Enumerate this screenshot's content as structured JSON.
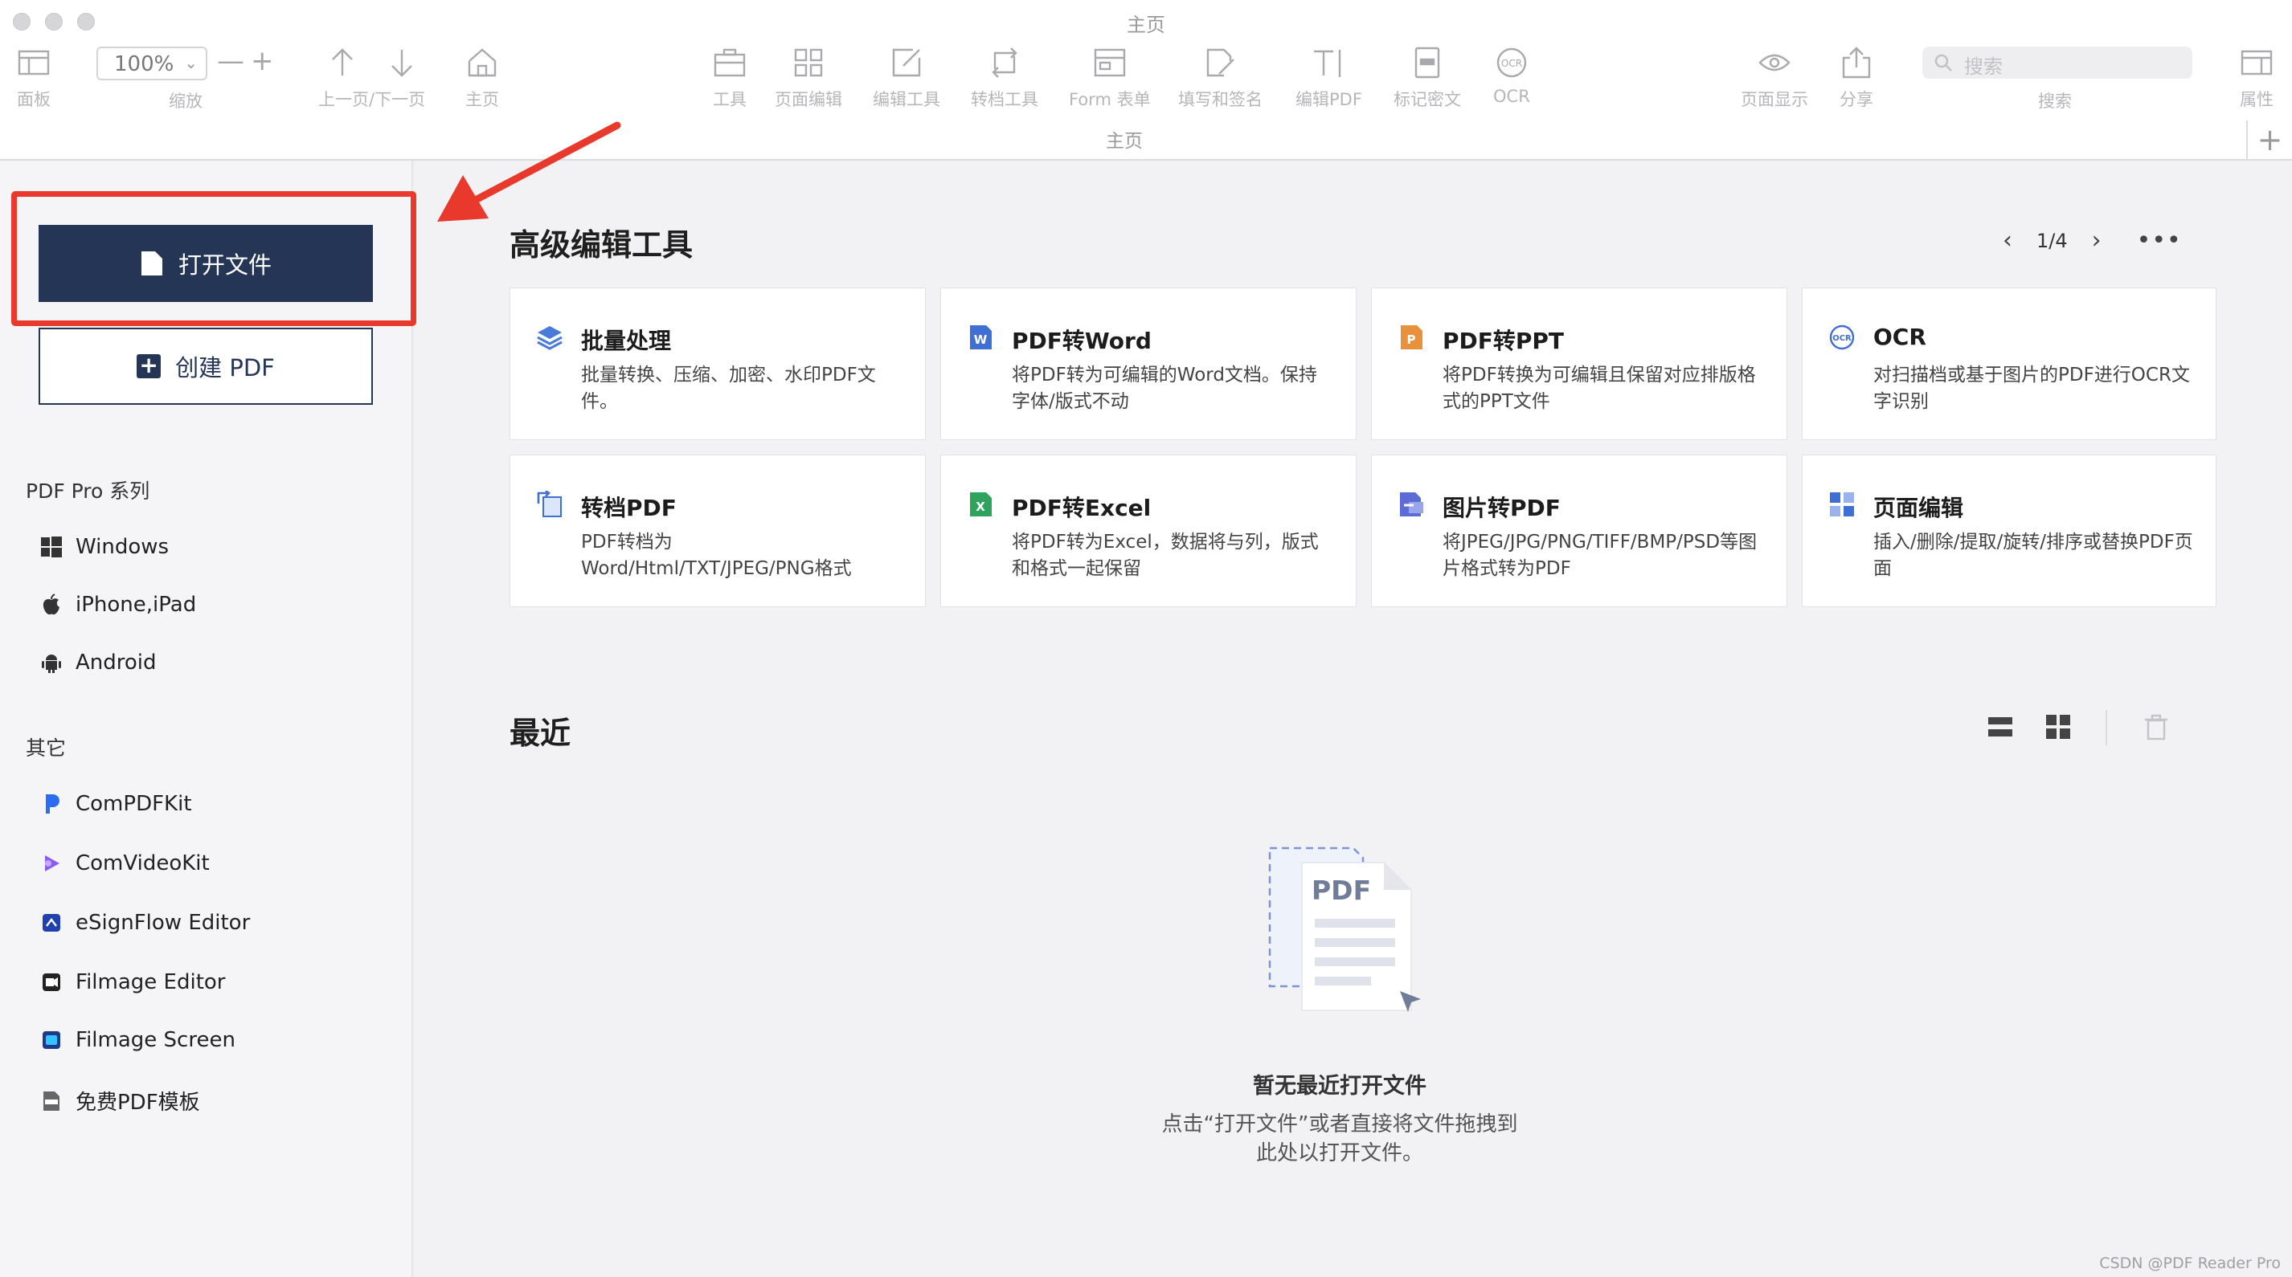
{
  "window": {
    "title": "主页"
  },
  "toolbar": {
    "panel": "面板",
    "zoom_value": "100%",
    "zoom_label": "缩放",
    "zoom_minus": "—",
    "zoom_plus": "+",
    "prev_next": "上一页/下一页",
    "home": "主页",
    "tools": "工具",
    "page_edit": "页面编辑",
    "edit_tools": "编辑工具",
    "convert_tools": "转档工具",
    "form": "Form 表单",
    "fill_sign": "填写和签名",
    "edit_pdf": "编辑PDF",
    "redact": "标记密文",
    "ocr": "OCR",
    "page_display": "页面显示",
    "share": "分享",
    "search_placeholder": "搜索",
    "search_label": "搜索",
    "properties": "属性",
    "tab_title": "主页",
    "tab_add": "+"
  },
  "sidebar": {
    "open_file": "打开文件",
    "create_pdf": "创建 PDF",
    "series_title": "PDF Pro 系列",
    "series": [
      {
        "label": "Windows",
        "icon": "windows-icon"
      },
      {
        "label": "iPhone,iPad",
        "icon": "apple-icon"
      },
      {
        "label": "Android",
        "icon": "android-icon"
      }
    ],
    "other_title": "其它",
    "others": [
      {
        "label": "ComPDFKit",
        "icon": "compdfkit-icon"
      },
      {
        "label": "ComVideoKit",
        "icon": "comvideokit-icon"
      },
      {
        "label": "eSignFlow Editor",
        "icon": "esignflow-icon"
      },
      {
        "label": "Filmage Editor",
        "icon": "filmage-editor-icon"
      },
      {
        "label": "Filmage Screen",
        "icon": "filmage-screen-icon"
      },
      {
        "label": "免费PDF模板",
        "icon": "pdf-template-icon"
      }
    ]
  },
  "main": {
    "tools_title": "高级编辑工具",
    "pager": "1/4",
    "cards": [
      {
        "title": "批量处理",
        "desc": "批量转换、压缩、加密、水印PDF文件。",
        "icon": "batch-icon",
        "color": "#4a7bd8"
      },
      {
        "title": "PDF转Word",
        "desc": "将PDF转为可编辑的Word文档。保持字体/版式不动",
        "icon": "word-icon",
        "color": "#3f6fd4"
      },
      {
        "title": "PDF转PPT",
        "desc": "将PDF转换为可编辑且保留对应排版格式的PPT文件",
        "icon": "ppt-icon",
        "color": "#e8913a"
      },
      {
        "title": "OCR",
        "desc": "对扫描档或基于图片的PDF进行OCR文字识别",
        "icon": "ocr-icon",
        "color": "#3f6fd4"
      },
      {
        "title": "转档PDF",
        "desc": "PDF转档为Word/Html/TXT/JPEG/PNG格式",
        "icon": "convert-icon",
        "color": "#3f6fd4"
      },
      {
        "title": "PDF转Excel",
        "desc": "将PDF转为Excel，数据将与列，版式和格式一起保留",
        "icon": "excel-icon",
        "color": "#2fa35e"
      },
      {
        "title": "图片转PDF",
        "desc": "将JPEG/JPG/PNG/TIFF/BMP/PSD等图片格式转为PDF",
        "icon": "image-to-pdf-icon",
        "color": "#5c6bd6"
      },
      {
        "title": "页面编辑",
        "desc": "插入/删除/提取/旋转/排序或替换PDF页面",
        "icon": "page-edit-icon",
        "color": "#3f6fd4"
      }
    ],
    "recent_title": "最近",
    "empty_title": "暂无最近打开文件",
    "empty_desc_line1": "点击“打开文件”或者直接将文件拖拽到",
    "empty_desc_line2": "此处以打开文件。",
    "empty_pdf_label": "PDF"
  },
  "watermark": "CSDN @PDF Reader Pro",
  "colors": {
    "primary": "#243556",
    "highlight": "#e8392c"
  }
}
